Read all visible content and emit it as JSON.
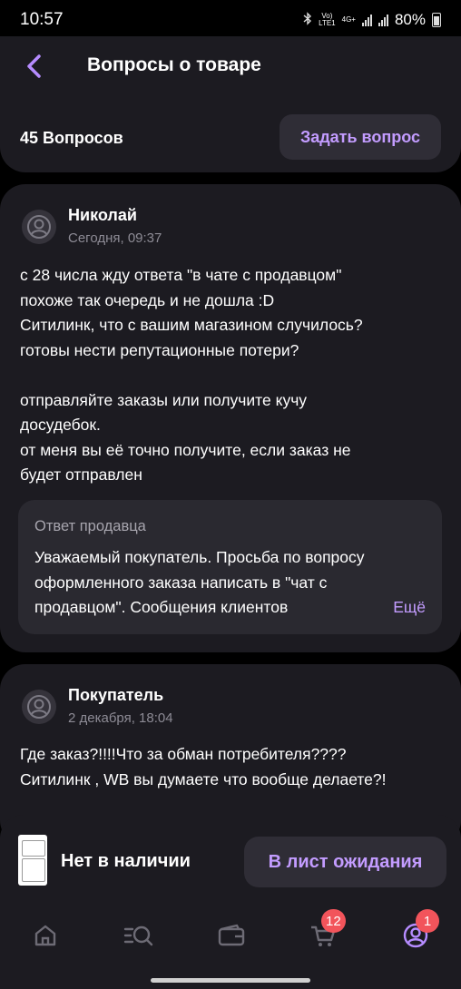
{
  "status_bar": {
    "time": "10:57",
    "network_top": "Vo)",
    "network_bottom": "LTE1",
    "net_type": "4G+",
    "battery": "80%"
  },
  "header": {
    "title": "Вопросы о товаре",
    "question_count": "45 Вопросов",
    "ask_button": "Задать вопрос"
  },
  "questions": [
    {
      "author": "Николай",
      "date": "Сегодня, 09:37",
      "text": "с 28 числа жду ответа \"в чате с продавцом\"\nпохоже так очередь и не дошла :D\nСитилинк, что с вашим магазином случилось?\nготовы нести репутационные потери?\n\nотправляйте заказы или получите кучу\nдосудебок.\nот меня вы её точно получите, если заказ не\nбудет отправлен",
      "answer": {
        "label": "Ответ продавца",
        "text": "Уважаемый покупатель. Просьба по вопросу\nоформленного заказа написать в \"чат с\nпродавцом\". Сообщения клиентов",
        "more": "Ещё"
      }
    },
    {
      "author": "Покупатель",
      "date": "2 декабря, 18:04",
      "text": "Где заказ?!!!!Что за обман потребителя????\nСитилинк , WB вы думаете что вообще делаете?!"
    }
  ],
  "product_bar": {
    "stock_status": "Нет в наличии",
    "wait_button": "В лист ожидания"
  },
  "bottom_nav": {
    "items": [
      {
        "icon": "home-icon"
      },
      {
        "icon": "catalog-search-icon"
      },
      {
        "icon": "wallet-icon"
      },
      {
        "icon": "cart-icon",
        "badge": "12"
      },
      {
        "icon": "profile-icon",
        "badge": "1"
      }
    ]
  },
  "colors": {
    "accent": "#c39cff",
    "card": "#1c1b21",
    "badge": "#f2545b"
  }
}
